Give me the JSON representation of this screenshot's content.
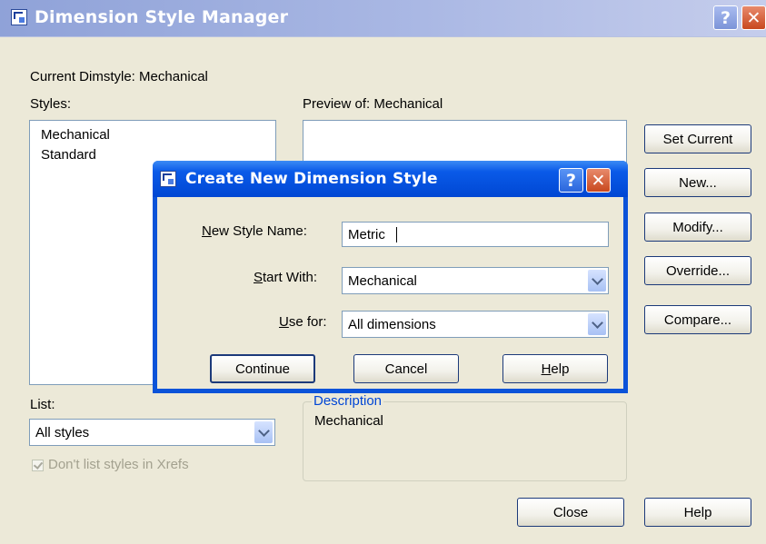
{
  "main": {
    "title": "Dimension Style Manager",
    "current_dimstyle": "Current Dimstyle: Mechanical",
    "styles_label": "Styles:",
    "styles": [
      "Mechanical",
      "Standard"
    ],
    "preview_label": "Preview of: Mechanical",
    "buttons": {
      "set_current": "Set Current",
      "new": "New...",
      "modify": "Modify...",
      "override": "Override...",
      "compare": "Compare...",
      "close": "Close",
      "help": "Help"
    },
    "list_label": "List:",
    "list_value": "All styles",
    "dont_list_xrefs": "Don't list styles in Xrefs",
    "description_label": "Description",
    "description_text": "Mechanical",
    "titlebar_help": "?",
    "titlebar_close": "✕"
  },
  "dialog": {
    "title": "Create New Dimension Style",
    "new_style_label_accel": "N",
    "new_style_label_rest": "ew Style Name:",
    "new_style_value": "Metric",
    "start_with_label_accel": "S",
    "start_with_label_rest": "tart With:",
    "start_with_value": "Mechanical",
    "use_for_label_accel": "U",
    "use_for_label_rest": "se for:",
    "use_for_value": "All dimensions",
    "continue": "Continue",
    "cancel": "Cancel",
    "help_accel": "H",
    "help_rest": "elp",
    "titlebar_help": "?",
    "titlebar_close": "✕"
  },
  "colors": {
    "window_bg": "#ece9d8",
    "dialog_title_blue": "#0a5ae8",
    "inactive_title": "#aab8e4",
    "close_red": "#c8481e",
    "group_label_blue": "#0046d5"
  }
}
